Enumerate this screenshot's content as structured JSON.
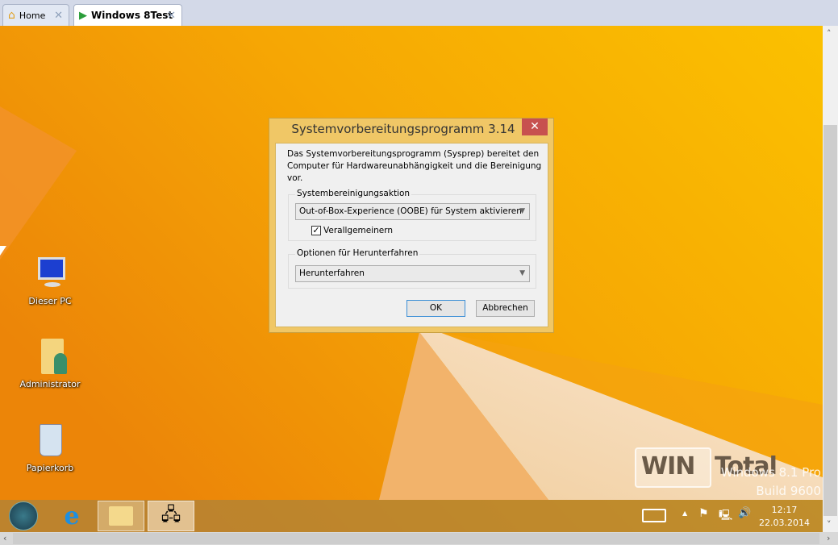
{
  "tabs": [
    {
      "label": "Home",
      "icon": "home-icon"
    },
    {
      "label": "Windows 8Test",
      "icon": "vm-play-icon"
    }
  ],
  "desktop_icons": [
    {
      "label": "Dieser PC",
      "icon": "computer-icon"
    },
    {
      "label": "Administrator",
      "icon": "user-folder-icon"
    },
    {
      "label": "Papierkorb",
      "icon": "recycle-bin-icon"
    }
  ],
  "dialog": {
    "title": "Systemvorbereitungsprogramm 3.14",
    "description_line1": "Das Systemvorbereitungsprogramm (Sysprep) bereitet den",
    "description_line2": "Computer für Hardwareunabhängigkeit und die Bereinigung vor.",
    "cleanup_label": "Systembereinigungsaktion",
    "cleanup_value": "Out-of-Box-Experience (OOBE) für System aktivieren",
    "generalize_label": "Verallgemeinern",
    "generalize_checked": true,
    "shutdown_label": "Optionen für Herunterfahren",
    "shutdown_value": "Herunterfahren",
    "ok": "OK",
    "cancel": "Abbrechen"
  },
  "watermark": {
    "line1": "Windows 8.1 Pro",
    "line2": "Build 9600",
    "logo_text": "WIN Total"
  },
  "taskbar": {
    "apps": [
      "start",
      "internet-explorer",
      "file-explorer",
      "network-app"
    ],
    "time": "12:17",
    "date": "22.03.2014"
  },
  "colors": {
    "accent_close": "#c7504f",
    "dialog_frame": "#f0c766"
  }
}
